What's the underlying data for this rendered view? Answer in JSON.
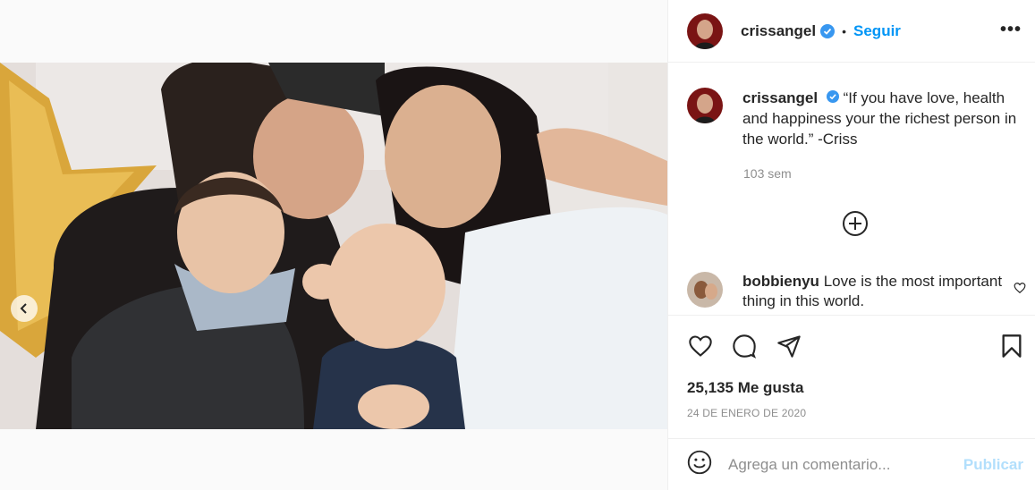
{
  "post": {
    "username": "crissangel",
    "follow_label": "Seguir",
    "separator": "•",
    "more_label": "•••",
    "caption_text": "“If you have love, health and happiness your the richest person in the world.” -Criss",
    "time_ago": "103 sem",
    "likes": "25,135 Me gusta",
    "date": "24 DE ENERO DE 2020"
  },
  "comments": [
    {
      "username": "bobbienyu",
      "text": "Love is the most important thing in this world."
    }
  ],
  "carousel": {
    "current_slide": 2,
    "total_slides": 2
  },
  "add_comment": {
    "placeholder": "Agrega un comentario...",
    "publish_label": "Publicar"
  },
  "icons": {
    "verified": "verified-badge-icon",
    "more": "more-options-icon",
    "load_more": "plus-circle-icon",
    "like": "heart-icon",
    "comment": "comment-bubble-icon",
    "share": "paper-plane-icon",
    "save": "bookmark-icon",
    "emoji": "emoji-icon",
    "prev": "chevron-left-icon"
  },
  "colors": {
    "accent": "#0095f6",
    "publish_disabled": "#b2dffc",
    "muted": "#8e8e8e"
  }
}
